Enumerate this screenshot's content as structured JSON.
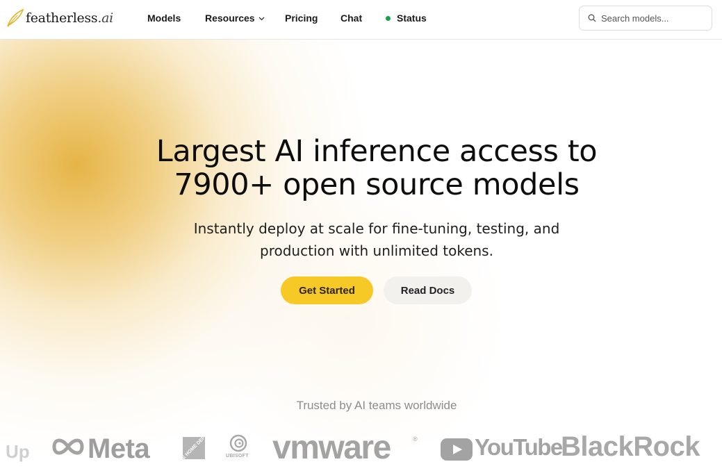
{
  "nav": {
    "logo_main": "featherless",
    "logo_suffix": ".ai",
    "links": {
      "models": "Models",
      "resources": "Resources",
      "pricing": "Pricing",
      "chat": "Chat",
      "status": "Status"
    },
    "search_placeholder": "Search models..."
  },
  "hero": {
    "headline_line1": "Largest AI inference access to",
    "headline_line2": "7900+ open source models",
    "subline_line1": "Instantly deploy at scale for fine-tuning, testing, and",
    "subline_line2": "production with unlimited tokens.",
    "primary_cta": "Get Started",
    "secondary_cta": "Read Docs"
  },
  "trusted": {
    "label": "Trusted by AI teams worldwide",
    "logos": {
      "up": "Up",
      "meta": "Meta",
      "home_depot": "THE HOME DEPOT",
      "ubisoft": "UBISOFT",
      "vmware": "vmware",
      "vmware_reg": "®",
      "youtube": "YouTube",
      "blackrock": "BlackRock"
    }
  },
  "colors": {
    "accent_yellow": "#f7c926",
    "status_green": "#16a34a",
    "glow": "#e4b03c"
  }
}
